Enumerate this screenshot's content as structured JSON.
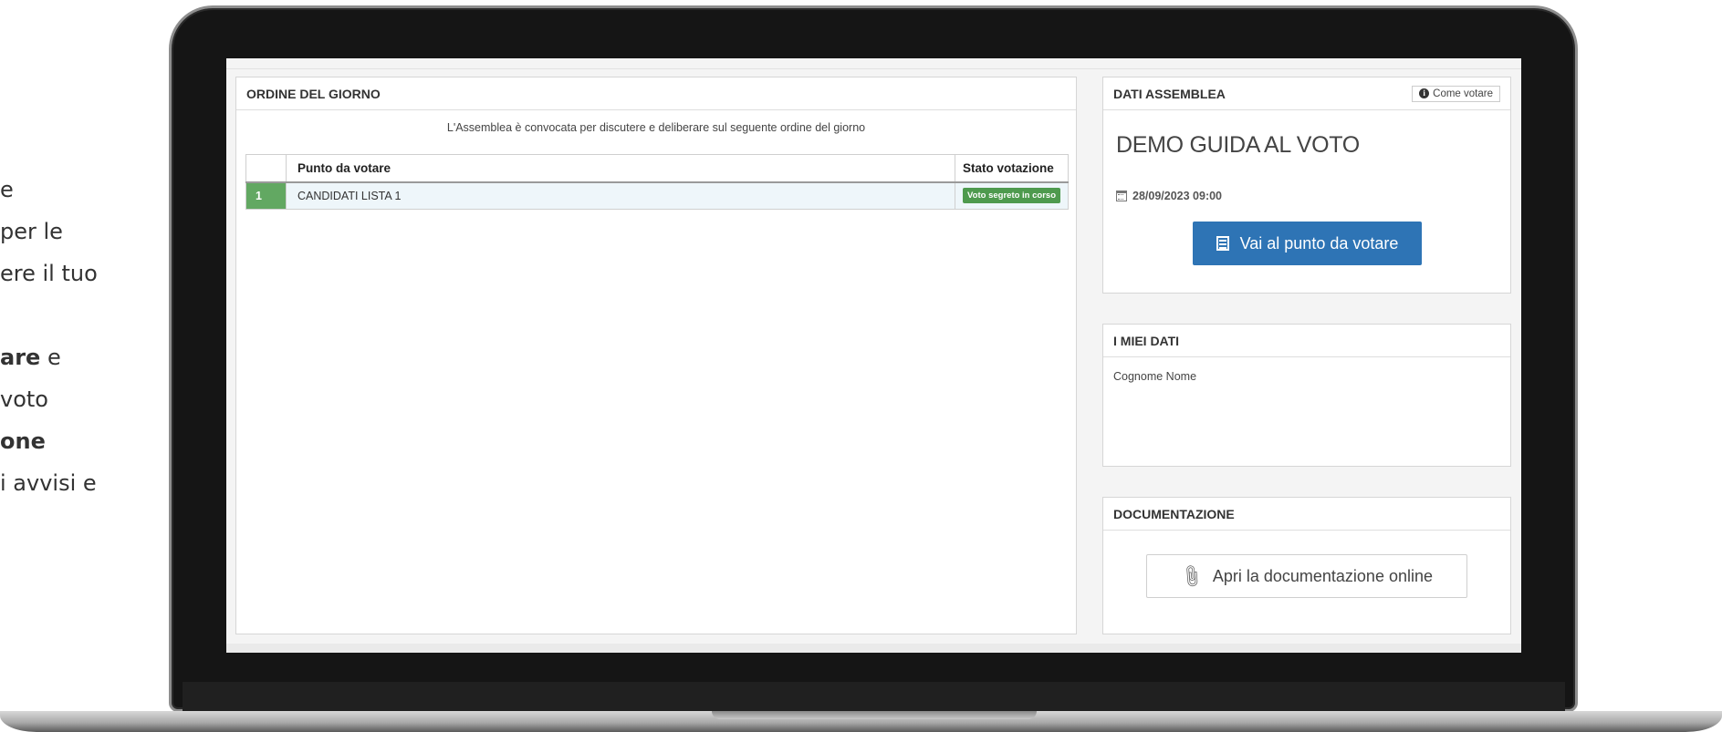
{
  "side_text": {
    "line1": "e",
    "line2": "per le",
    "line3": "ere il tuo",
    "line4_bold": "are",
    "line4_rest": " e",
    "line5": "voto",
    "line6_bold": "one",
    "line7": "i avvisi e"
  },
  "ordine": {
    "title": "ORDINE DEL GIORNO",
    "intro": "L'Assemblea è convocata per discutere e deliberare sul seguente ordine del giorno",
    "headers": {
      "num": "",
      "punto": "Punto da votare",
      "stato": "Stato votazione"
    },
    "rows": [
      {
        "num": "1",
        "punto": "CANDIDATI LISTA 1",
        "stato": "Voto segreto in corso"
      }
    ]
  },
  "dati_assemblea": {
    "title": "DATI ASSEMBLEA",
    "come_votare": "Come votare",
    "event_name": "DEMO GUIDA AL VOTO",
    "date": "28/09/2023 09:00",
    "vai_button": "Vai al punto da votare"
  },
  "miei_dati": {
    "title": "I MIEI DATI",
    "name": "Cognome Nome"
  },
  "documentazione": {
    "title": "DOCUMENTAZIONE",
    "button": "Apri la documentazione online"
  },
  "colors": {
    "primary": "#2e74b5",
    "success": "#4e9a4e",
    "row_number": "#62a862"
  }
}
